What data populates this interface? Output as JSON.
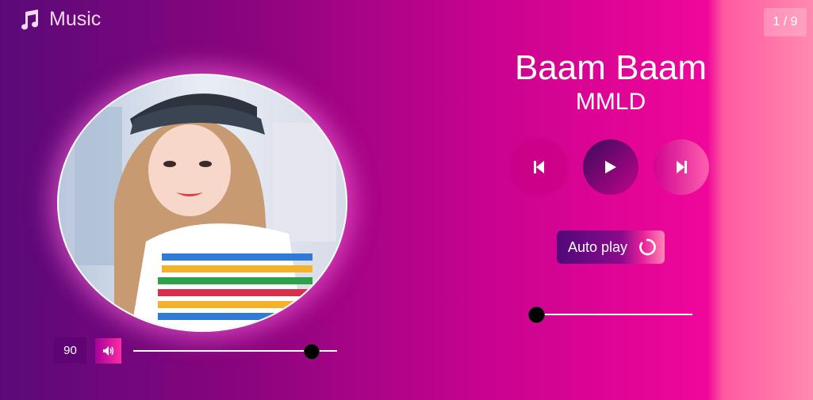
{
  "app": {
    "title": "Music"
  },
  "counter": {
    "text": "1 / 9"
  },
  "song": {
    "name": "Baam Baam",
    "artist": "MMLD"
  },
  "controls": {
    "autoplay_label": "Auto play"
  },
  "volume": {
    "value": "90",
    "level": 0.87
  },
  "progress": {
    "level": 0.0
  },
  "icons": [
    "music-note-icon",
    "volume-icon",
    "prev-icon",
    "play-icon",
    "next-icon",
    "repeat-icon"
  ],
  "colors": {
    "accent": "#f0069a",
    "deep": "#5a0a78"
  }
}
